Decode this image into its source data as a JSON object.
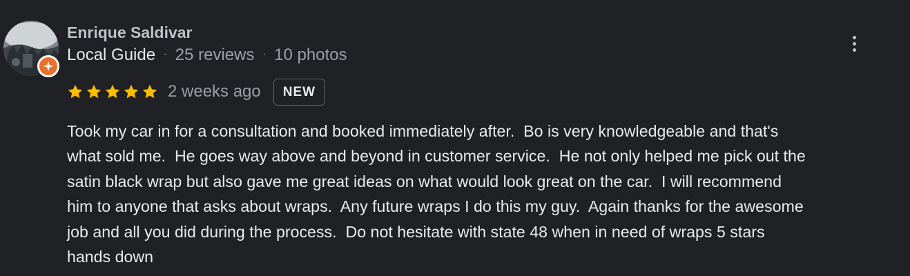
{
  "review": {
    "reviewer_name": "Enrique Saldivar",
    "local_guide_label": "Local Guide",
    "separator": "·",
    "reviews_count": "25 reviews",
    "photos_count": "10 photos",
    "rating": 5,
    "rating_max": 5,
    "date": "2 weeks ago",
    "badge": "NEW",
    "text": "Took my car in for a consultation and booked immediately after.  Bo is very knowledgeable and that's\nwhat sold me.  He goes way above and beyond in customer service.  He not only helped me pick out the\nsatin black wrap but also gave me great ideas on what would look great on the car.  I will recommend\nhim to anyone that asks about wraps.  Any future wraps I do this my guy.  Again thanks for the awesome\njob and all you did during the process.  Do not hesitate with state 48 when in need of wraps 5 stars\nhands down"
  },
  "colors": {
    "background": "#202124",
    "star": "#fbbc04",
    "local_guide_badge": "#e8702a",
    "primary_text": "#e8eaed",
    "secondary_text": "#9aa0a6"
  },
  "icons": {
    "avatar": "profile-photo",
    "guide_badge": "local-guide-star-icon",
    "more": "more-vertical-icon",
    "star": "star-icon"
  }
}
